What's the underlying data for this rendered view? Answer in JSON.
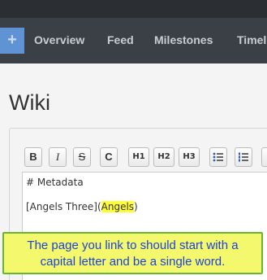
{
  "nav": {
    "plus_label": "+",
    "items": [
      "Overview",
      "Feed",
      "Milestones",
      "Timel"
    ]
  },
  "page": {
    "title": "Wiki"
  },
  "toolbar": {
    "bold": "B",
    "italic": "I",
    "strike": "S",
    "code": "C",
    "h1": "H1",
    "h2": "H2",
    "h3": "H3"
  },
  "editor": {
    "line1": "# Metadata",
    "line2_pre": "[Angels Three](",
    "line2_highlight": "Angels",
    "line2_post": ")"
  },
  "callout": {
    "line1": "The page you link to should start with a",
    "line2": "capital letter and be a single word."
  }
}
